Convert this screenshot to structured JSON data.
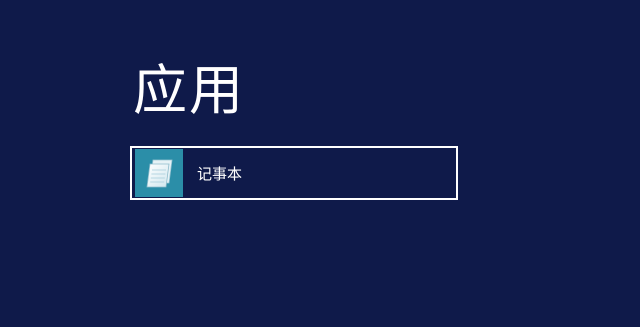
{
  "section": {
    "title": "应用"
  },
  "apps": [
    {
      "label": "记事本",
      "icon": "notepad-icon"
    }
  ],
  "colors": {
    "background": "#0f1a4a",
    "tile_icon_bg": "#2b8ea8",
    "selection_border": "#ffffff"
  }
}
